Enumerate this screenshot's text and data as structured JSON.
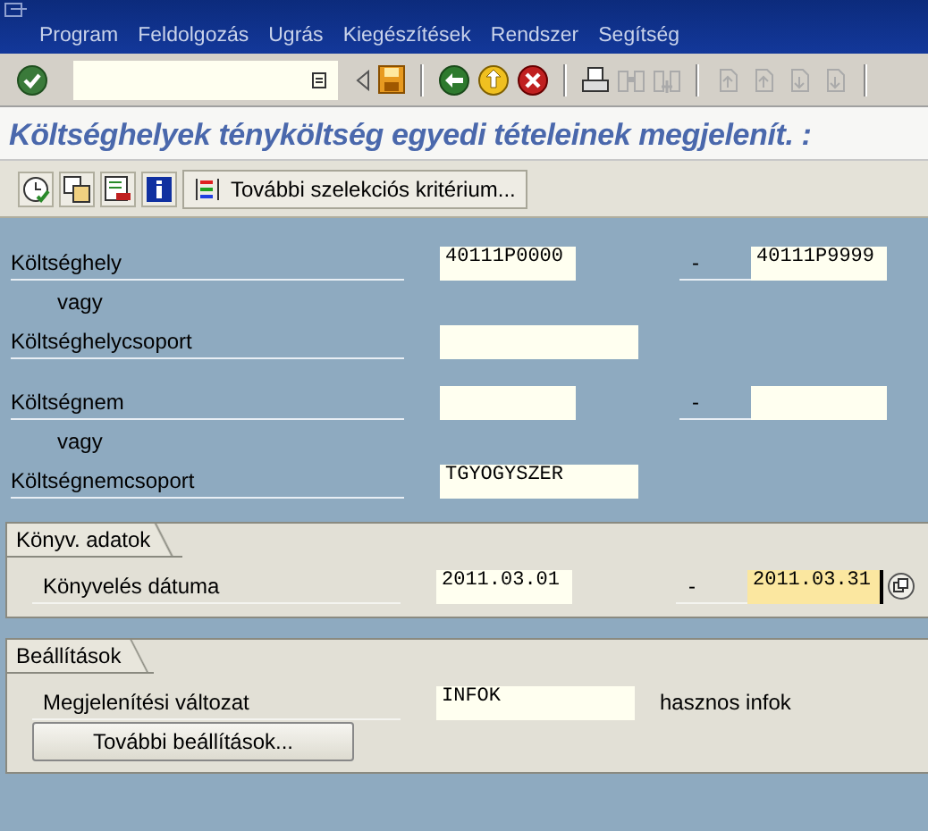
{
  "menu": [
    {
      "label": "Program"
    },
    {
      "label": "Feldolgozás"
    },
    {
      "label": "Ugrás"
    },
    {
      "label": "Kiegészítések"
    },
    {
      "label": "Rendszer"
    },
    {
      "label": "Segítség"
    }
  ],
  "title": "Költséghelyek tényköltség egyedi tételeinek megjelenít. :",
  "app_toolbar": {
    "button": "További szelekciós kritérium..."
  },
  "selection": [
    [
      {
        "kind": "range",
        "label": "Költséghely",
        "low": "40111P0000",
        "separator": "-",
        "high": "40111P9999"
      },
      {
        "kind": "note",
        "label": "vagy"
      },
      {
        "kind": "single",
        "label": "Költséghelycsoport"
      }
    ],
    [
      {
        "kind": "range",
        "label": "Költségnem",
        "separator": "-"
      },
      {
        "kind": "note",
        "label": "vagy"
      },
      {
        "kind": "single",
        "label": "Költségnemcsoport",
        "value": "TGYOGYSZER"
      }
    ]
  ],
  "groups": [
    {
      "title": "Könyv. adatok",
      "rows": [
        {
          "kind": "range",
          "label": "Könyvelés dátuma",
          "low": "2011.03.01",
          "separator": "-",
          "high": "2011.03.31",
          "high_focused": true,
          "multiple_selection": true
        }
      ]
    },
    {
      "title": "Beállítások",
      "rows": [
        {
          "kind": "single",
          "label": "Megjelenítési változat",
          "value": "INFOK",
          "description": "hasznos infok"
        },
        {
          "kind": "button",
          "label": "További beállítások..."
        }
      ]
    }
  ]
}
